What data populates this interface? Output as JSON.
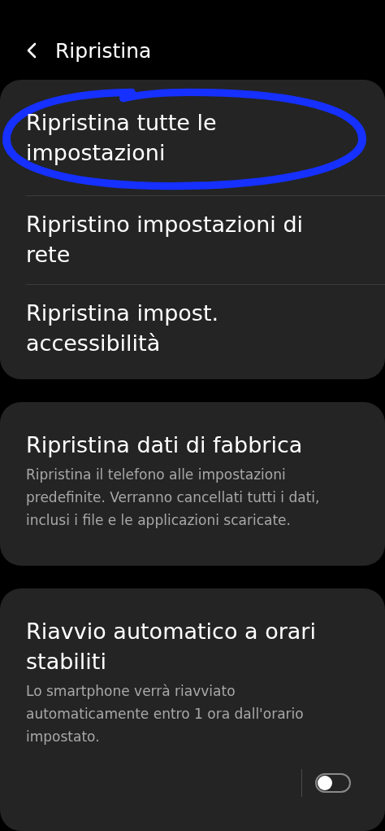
{
  "header": {
    "title": "Ripristina"
  },
  "groups": [
    {
      "items": [
        {
          "title": "Ripristina tutte le impostazioni",
          "highlighted": true
        },
        {
          "title": "Ripristino impostazioni di rete",
          "highlighted": false
        },
        {
          "title": "Ripristina impost. accessibilità",
          "highlighted": false
        }
      ]
    },
    {
      "items": [
        {
          "title": "Ripristina dati di fabbrica",
          "description": "Ripristina il telefono alle impostazioni predefinite. Verranno cancellati tutti i dati, inclusi i file e le applicazioni scaricate.",
          "highlighted": false
        }
      ]
    },
    {
      "items": [
        {
          "title": "Riavvio automatico a orari stabiliti",
          "description": "Lo smartphone verrà riavviato automaticamente entro 1 ora dall'orario impostato.",
          "highlighted": false,
          "toggle": {
            "on": false
          }
        }
      ]
    }
  ]
}
